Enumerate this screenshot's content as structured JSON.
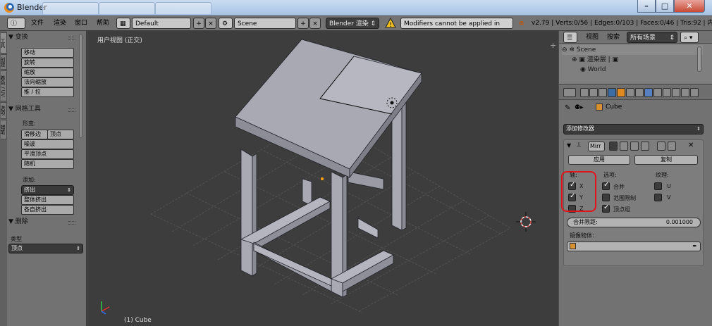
{
  "window": {
    "title": "Blender",
    "minimize": "–",
    "maximize": "□",
    "close": "✕"
  },
  "infobar": {
    "menus": [
      "文件",
      "渲染",
      "窗口",
      "帮助"
    ],
    "layout": "Default",
    "scene": "Scene",
    "engine": "Blender 渲染",
    "warning": "Modifiers cannot be applied in edit mode",
    "stats": "v2.79 | Verts:0/56 | Edges:0/103 | Faces:0/46 | Tris:92 | 内存:19.8"
  },
  "toolshelf": {
    "vertical_tabs": [
      "工具",
      "创建",
      "着色 / UV",
      "选项",
      "蜡笔"
    ],
    "transform": {
      "title": "▼ 变换",
      "buttons": [
        "移动",
        "旋转",
        "缩放",
        "法向缩放",
        "推 / 拉"
      ]
    },
    "mesh_tools": {
      "title": "▼ 网格工具",
      "deform_label": "形变:",
      "slide_edge": "滑移边",
      "vertex": "顶点",
      "deform_buttons": [
        "噪波",
        "平滑顶点",
        "随机"
      ],
      "add_label": "添加:",
      "extrude": "挤出",
      "add_buttons": [
        "整体挤出",
        "各自挤出"
      ]
    },
    "delete": {
      "title": "▼ 删除",
      "type_label": "类型",
      "type_value": "顶点"
    }
  },
  "viewport": {
    "title": "用户视图 (正交)",
    "object_label": "(1) Cube"
  },
  "outliner": {
    "view": "视图",
    "search": "搜索",
    "scenes_dropdown": "所有场景",
    "rows": [
      "Scene",
      "渲染层",
      "World"
    ]
  },
  "properties": {
    "object_name": "Cube",
    "add_modifier": "添加修改器",
    "modifier_name": "Mirr",
    "apply": "应用",
    "copy": "复制",
    "axis_label": "轴:",
    "options_label": "选项:",
    "texture_label": "纹理:",
    "axes": [
      {
        "label": "X",
        "checked": true
      },
      {
        "label": "Y",
        "checked": true
      },
      {
        "label": "Z",
        "checked": false
      }
    ],
    "options": [
      {
        "label": "合并",
        "checked": true
      },
      {
        "label": "范围限制",
        "checked": false
      },
      {
        "label": "顶点组",
        "checked": true
      }
    ],
    "textures": [
      {
        "label": "U",
        "checked": false
      },
      {
        "label": "V",
        "checked": false
      }
    ],
    "merge_limit_label": "合并限距:",
    "merge_limit_value": "0.001000",
    "mirror_object_label": "镜像物体:"
  },
  "colors": {
    "highlight": "#e0141a",
    "viewport_bg": "#3d3d3d",
    "panel_bg": "#727272",
    "mesh_face": "#a9a9b4"
  }
}
